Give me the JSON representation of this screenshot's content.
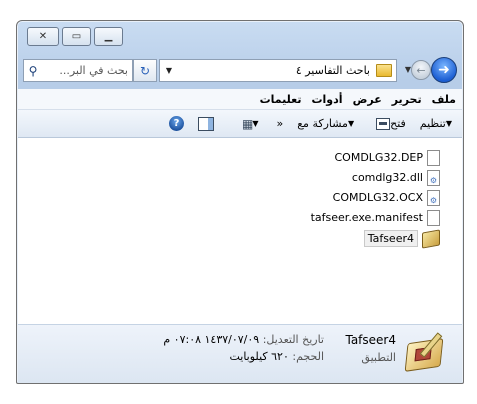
{
  "window": {
    "caption": {
      "close": "✕",
      "maximize": "▭",
      "minimize": "▁"
    }
  },
  "address": {
    "path": "باحث التفاسير ٤",
    "refresh_glyph": "↻",
    "back_glyph": "➜",
    "forward_glyph": "←",
    "search_placeholder": "بحث في البر..."
  },
  "menu": {
    "items": [
      "ملف",
      "تحرير",
      "عرض",
      "أدوات",
      "تعليمات"
    ]
  },
  "commands": {
    "organize": "تنظيم",
    "open": "فتح",
    "share": "مشاركة مع",
    "more": "»",
    "help_glyph": "?"
  },
  "files": [
    {
      "name": "COMDLG32.DEP",
      "icon": "document-icon"
    },
    {
      "name": "comdlg32.dll",
      "icon": "dll-icon"
    },
    {
      "name": "COMDLG32.OCX",
      "icon": "dll-icon"
    },
    {
      "name": "tafseer.exe.manifest",
      "icon": "document-icon"
    },
    {
      "name": "Tafseer4",
      "icon": "app-icon",
      "selected": true
    }
  ],
  "details": {
    "name": "Tafseer4",
    "type": "التطبيق",
    "modified_label": "تاريخ التعديل:",
    "modified_value": "١٤٣٧/٠٧/٠٩ ٠٧:٠٨ م",
    "size_label": "الحجم:",
    "size_value": "٦٢٠ كيلوبايت"
  }
}
